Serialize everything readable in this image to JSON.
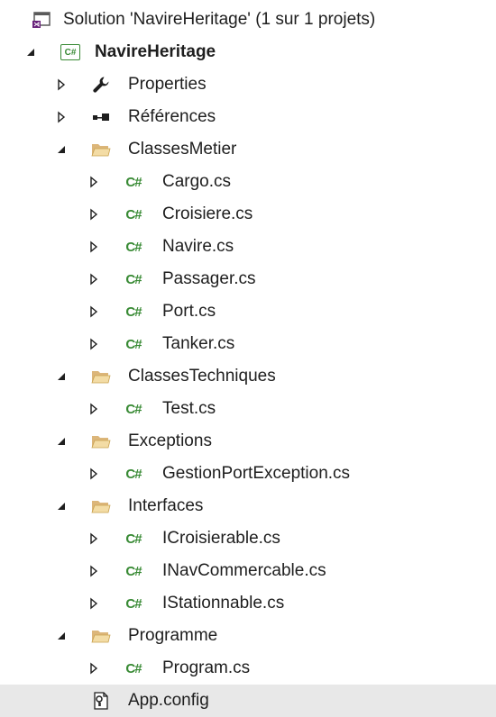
{
  "solution": {
    "label": "Solution 'NavireHeritage' (1 sur 1 projets)",
    "icon": "visual-studio-solution-icon"
  },
  "project": {
    "label": "NavireHeritage",
    "icon": "csharp-project-icon",
    "cs_badge": "C#",
    "expanded": true
  },
  "properties": {
    "label": "Properties",
    "icon": "wrench-icon",
    "expanded": false
  },
  "references": {
    "label": "Références",
    "icon": "references-icon",
    "expanded": false
  },
  "folders": [
    {
      "label": "ClassesMetier",
      "expanded": true,
      "files": [
        {
          "label": "Cargo.cs"
        },
        {
          "label": "Croisiere.cs"
        },
        {
          "label": "Navire.cs"
        },
        {
          "label": "Passager.cs"
        },
        {
          "label": "Port.cs"
        },
        {
          "label": "Tanker.cs"
        }
      ]
    },
    {
      "label": "ClassesTechniques",
      "expanded": true,
      "files": [
        {
          "label": "Test.cs"
        }
      ]
    },
    {
      "label": "Exceptions",
      "expanded": true,
      "files": [
        {
          "label": "GestionPortException.cs"
        }
      ]
    },
    {
      "label": "Interfaces",
      "expanded": true,
      "files": [
        {
          "label": "ICroisierable.cs"
        },
        {
          "label": "INavCommercable.cs"
        },
        {
          "label": "IStationnable.cs"
        }
      ]
    },
    {
      "label": "Programme",
      "expanded": true,
      "files": [
        {
          "label": "Program.cs"
        }
      ]
    }
  ],
  "app_config": {
    "label": "App.config",
    "icon": "config-file-icon",
    "selected": true
  },
  "cs_file_glyph": "C#",
  "colors": {
    "folder": "#dcb67a",
    "csharp_green": "#388a34",
    "vs_purple": "#68217a",
    "selection": "#e8e8e8"
  }
}
